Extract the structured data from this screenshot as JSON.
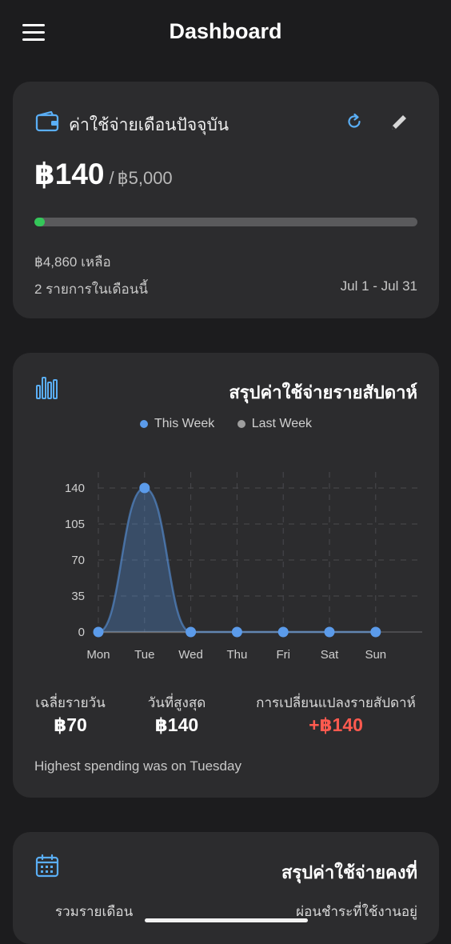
{
  "header": {
    "title": "Dashboard",
    "menu_icon": "hamburger-menu-icon"
  },
  "budget_card": {
    "title": "ค่าใช้จ่ายเดือนปัจจุบัน",
    "spent": "฿140",
    "separator": "/",
    "budget": "฿5,000",
    "progress_fraction": 0.028,
    "progress_color": "#34c759",
    "remaining": "฿4,860 เหลือ",
    "transactions": "2 รายการในเดือนนี้",
    "date_range": "Jul 1 - Jul 31",
    "icons": [
      "wallet-icon",
      "refresh-icon",
      "edit-icon"
    ]
  },
  "weekly_card": {
    "title": "สรุปค่าใช้จ่ายรายสัปดาห์",
    "legend": [
      {
        "label": "This Week",
        "color": "#5b9bea"
      },
      {
        "label": "Last Week",
        "color": "#9e9e9e"
      }
    ],
    "stats": [
      {
        "label": "เฉลี่ยรายวัน",
        "value": "฿70",
        "color": "#ffffff"
      },
      {
        "label": "วันที่สูงสุด",
        "value": "฿140",
        "color": "#ffffff"
      },
      {
        "label": "การเปลี่ยนแปลงรายสัปดาห์",
        "value": "+฿140",
        "color": "#ff5a4f"
      }
    ],
    "note": "Highest spending was on Tuesday"
  },
  "fixed_card": {
    "title": "สรุปค่าใช้จ่ายคงที่",
    "monthly_total_label": "รวมรายเดือน",
    "active_installments_label": "ผ่อนชำระที่ใช้งานอยู่"
  },
  "chart_data": {
    "type": "area",
    "categories": [
      "Mon",
      "Tue",
      "Wed",
      "Thu",
      "Fri",
      "Sat",
      "Sun"
    ],
    "series": [
      {
        "name": "This Week",
        "values": [
          0,
          140,
          0,
          0,
          0,
          0,
          0
        ],
        "color": "#5b9bea"
      },
      {
        "name": "Last Week",
        "values": [
          0,
          0,
          0,
          0,
          0,
          0,
          0
        ],
        "color": "#9e9e9e"
      }
    ],
    "yticks": [
      "0",
      "35",
      "70",
      "105",
      "140"
    ],
    "ylim": [
      0,
      140
    ],
    "grid": true
  }
}
